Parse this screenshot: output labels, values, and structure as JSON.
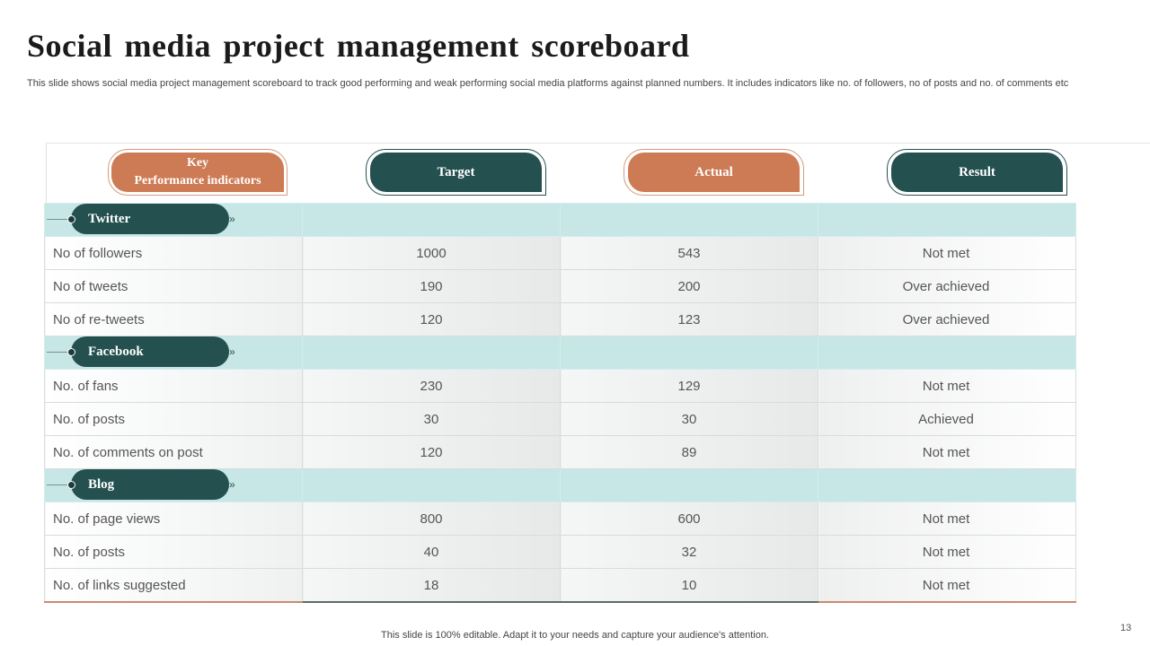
{
  "slide": {
    "title": "Social media project management scoreboard",
    "subtitle": "This slide shows social media project management scoreboard to track good performing and weak performing social media platforms against planned numbers. It includes indicators like no. of followers, no of posts and no. of comments etc",
    "footer": "This slide is 100% editable. Adapt it to your needs and capture your audience's attention.",
    "page_number": "13"
  },
  "headers": {
    "kpi_line1": "Key",
    "kpi_line2": "Performance  indicators",
    "target": "Target",
    "actual": "Actual",
    "result": "Result"
  },
  "sections": [
    {
      "name": "Twitter",
      "rows": [
        {
          "kpi": "No of followers",
          "target": "1000",
          "actual": "543",
          "result": "Not met"
        },
        {
          "kpi": "No of tweets",
          "target": "190",
          "actual": "200",
          "result": "Over achieved"
        },
        {
          "kpi": "No of re-tweets",
          "target": "120",
          "actual": "123",
          "result": "Over achieved"
        }
      ]
    },
    {
      "name": "Facebook",
      "rows": [
        {
          "kpi": "No. of fans",
          "target": "230",
          "actual": "129",
          "result": "Not met"
        },
        {
          "kpi": "No. of posts",
          "target": "30",
          "actual": "30",
          "result": "Achieved"
        },
        {
          "kpi": "No. of comments on post",
          "target": "120",
          "actual": "89",
          "result": "Not met"
        }
      ]
    },
    {
      "name": "Blog",
      "rows": [
        {
          "kpi": "No. of page views",
          "target": "800",
          "actual": "600",
          "result": "Not met"
        },
        {
          "kpi": "No. of posts",
          "target": "40",
          "actual": "32",
          "result": "Not met"
        },
        {
          "kpi": "No. of links suggested",
          "target": "18",
          "actual": "10",
          "result": "Not met"
        }
      ]
    }
  ],
  "colors": {
    "teal": "#245050",
    "orange": "#cd7b54",
    "section_band": "#c7e6e6"
  },
  "icons": {
    "section_arrow": "double-chevron-right-icon"
  }
}
